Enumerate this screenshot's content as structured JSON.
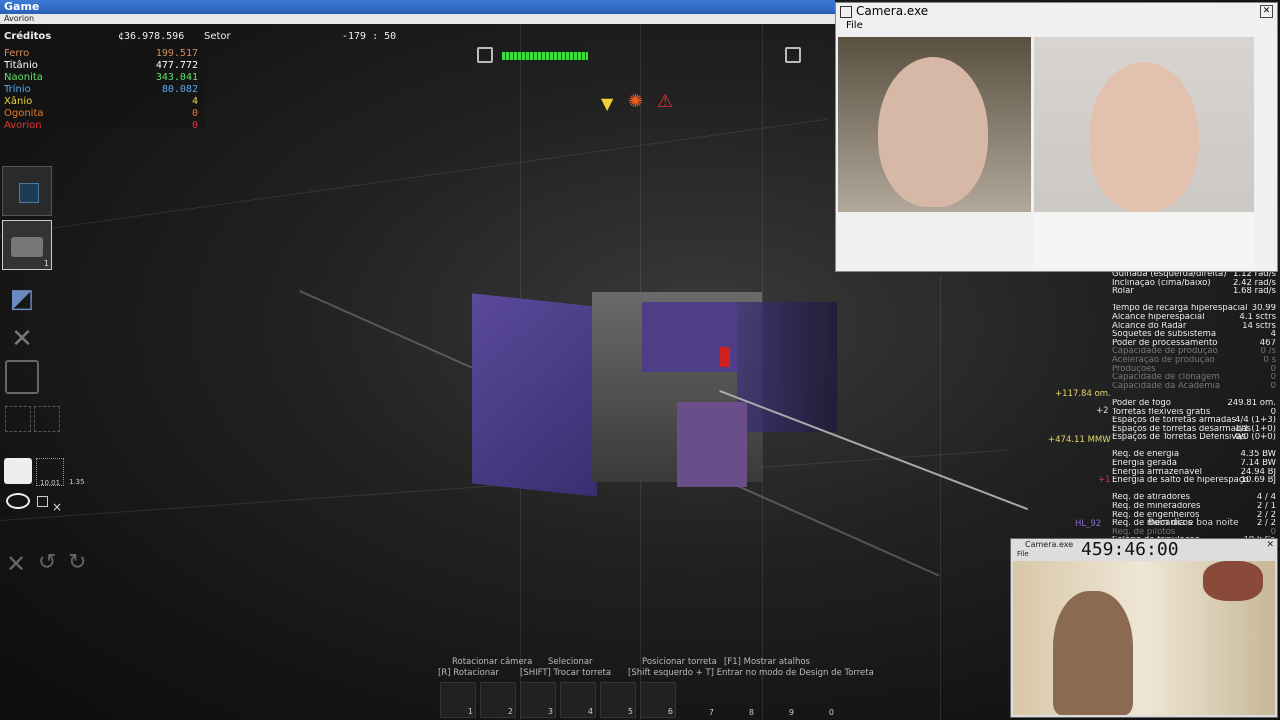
{
  "window": {
    "title": "Game",
    "subtitle": "Avorion"
  },
  "hud": {
    "credits_label": "Créditos",
    "credits_value": "¢36.978.596",
    "sector_label": "Setor",
    "coords": "-179 : 50",
    "resources": [
      {
        "name": "Ferro",
        "value": "199.517",
        "color": "#d68a5a"
      },
      {
        "name": "Titânio",
        "value": "477.772",
        "color": "#ffffff"
      },
      {
        "name": "Naonita",
        "value": "343.041",
        "color": "#5ee36a"
      },
      {
        "name": "Trínio",
        "value": "80.082",
        "color": "#5aa8e8"
      },
      {
        "name": "Xânio",
        "value": "4",
        "color": "#f2d23a"
      },
      {
        "name": "Ogonita",
        "value": "0",
        "color": "#e87a30"
      },
      {
        "name": "Avorion",
        "value": "0",
        "color": "#e83030"
      }
    ]
  },
  "toolbox": {
    "lock_counter": "10.01",
    "scale_counter": "1.35",
    "slot_badge": "1"
  },
  "stats": {
    "rows": [
      {
        "label": "Guinada (esquerda/direita)",
        "value": "1.12 rad/s",
        "dim": false
      },
      {
        "label": "Inclinação (cima/baixo)",
        "value": "2.42 rad/s",
        "dim": false
      },
      {
        "label": "Rolar",
        "value": "1.68 rad/s",
        "dim": false
      },
      {
        "label": "",
        "value": "",
        "dim": false
      },
      {
        "label": "Tempo de recarga hiperespacial",
        "value": "30.99",
        "dim": false
      },
      {
        "label": "Alcance hiperespacial",
        "value": "4.1 sctrs",
        "dim": false
      },
      {
        "label": "Alcance do Radar",
        "value": "14 sctrs",
        "dim": false
      },
      {
        "label": "Soquetes de subsistema",
        "value": "4",
        "dim": false
      },
      {
        "label": "Poder de processamento",
        "value": "467",
        "dim": false
      },
      {
        "label": "Capacidade de produção",
        "value": "0 /s",
        "dim": true
      },
      {
        "label": "Aceleração de produção",
        "value": "0 s",
        "dim": true
      },
      {
        "label": "Produções",
        "value": "0",
        "dim": true
      },
      {
        "label": "Capacidade de clonagem",
        "value": "0",
        "dim": true
      },
      {
        "label": "Capacidade da Academia",
        "value": "0",
        "dim": true
      },
      {
        "label": "",
        "value": "",
        "dim": false
      },
      {
        "label": "Poder de fogo",
        "value": "249.81 om.",
        "dim": false
      },
      {
        "label": "Torretas flexíveis grátis",
        "value": "0",
        "dim": false
      },
      {
        "label": "Espaços de torretas armadas",
        "value": "4/4 (1+3)",
        "dim": false
      },
      {
        "label": "Espaços de torretas desarmadas",
        "value": "1/1 (1+0)",
        "dim": false
      },
      {
        "label": "Espaços de Torretas Defensivas",
        "value": "0/0 (0+0)",
        "dim": false
      },
      {
        "label": "",
        "value": "",
        "dim": false
      },
      {
        "label": "Req. de energia",
        "value": "4.35 BW",
        "dim": false
      },
      {
        "label": "Energia gerada",
        "value": "7.14 BW",
        "dim": false
      },
      {
        "label": "Energia armazenável",
        "value": "24.94 BJ",
        "dim": false
      },
      {
        "label": "Energia de salto de hiperespaço",
        "value": "10.69 BJ",
        "dim": false
      },
      {
        "label": "",
        "value": "",
        "dim": false
      },
      {
        "label": "Req. de atiradores",
        "value": "4 / 4",
        "dim": false
      },
      {
        "label": "Req. de mineradores",
        "value": "2 / 1",
        "dim": false
      },
      {
        "label": "Req. de engenheiros",
        "value": "2 / 2",
        "dim": false
      },
      {
        "label": "Req. de mecânicos",
        "value": "2 / 2",
        "dim": false
      },
      {
        "label": "Req. de pilotos",
        "value": "0",
        "dim": true
      },
      {
        "label": "Salário da tripulação",
        "value": "19 k Cr.",
        "dim": false
      }
    ],
    "side_firepower": "+117.84 om.",
    "side_turrets": "+2",
    "side_energy": "+474.11 MMW",
    "side_crew": "+1",
    "player_name": "HL_92",
    "overlay_text": "Bom dia e boa noite"
  },
  "camera": {
    "title": "Camera.exe",
    "menu_file": "File"
  },
  "camera2": {
    "title": "Camera.exe",
    "menu_file": "File",
    "timer": "459:46:00"
  },
  "hints": {
    "rotate_camera": "Rotacionar câmera",
    "select": "Selecionar",
    "place_turret": "Posicionar torreta",
    "show_shortcuts": "[F1] Mostrar atalhos",
    "rotate": "[R] Rotacionar",
    "swap_turret": "[SHIFT] Trocar torreta",
    "design_mode": "[Shift esquerdo + T] Entrar no modo de Design de Torreta"
  },
  "hotbar": [
    "1",
    "2",
    "3",
    "4",
    "5",
    "6",
    "7",
    "8",
    "9",
    "0"
  ]
}
